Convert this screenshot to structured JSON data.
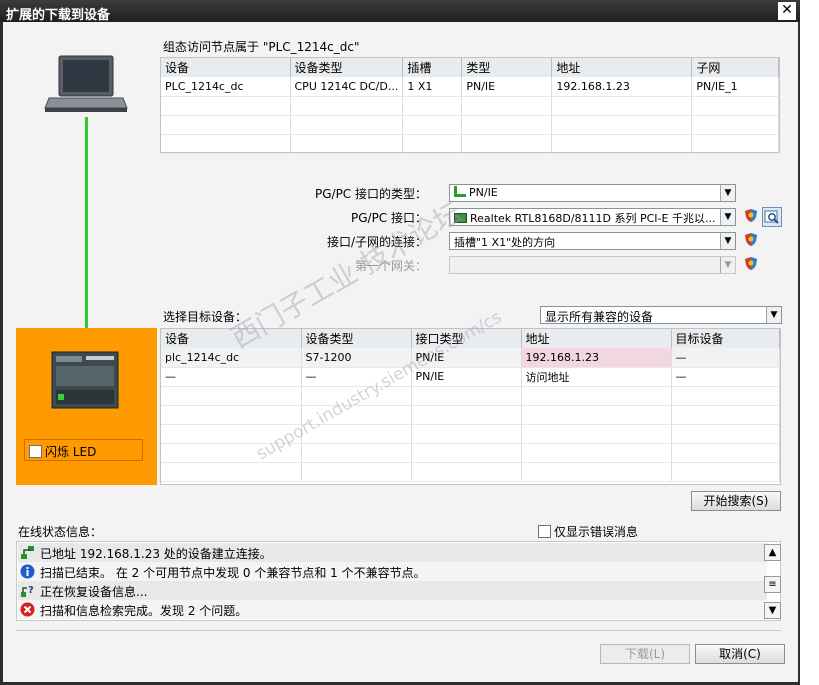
{
  "window": {
    "title": "扩展的下载到设备",
    "close": "✕"
  },
  "config_section": {
    "caption": "组态访问节点属于 \"PLC_1214c_dc\"",
    "headers": [
      "设备",
      "设备类型",
      "插槽",
      "类型",
      "地址",
      "子网"
    ],
    "row": [
      "PLC_1214c_dc",
      "CPU 1214C DC/D...",
      "1 X1",
      "PN/IE",
      "192.168.1.23",
      "PN/IE_1"
    ]
  },
  "interface": {
    "pgpc_type_label": "PG/PC 接口的类型：",
    "pgpc_type_value": "PN/IE",
    "pgpc_label": "PG/PC 接口：",
    "pgpc_value": "Realtek RTL8168D/8111D 系列 PCI-E 千兆以...",
    "subnet_label": "接口/子网的连接：",
    "subnet_value": "插槽\"1 X1\"处的方向",
    "gateway_label": "第一个网关：",
    "gateway_value": ""
  },
  "target_section": {
    "caption": "选择目标设备：",
    "filter_value": "显示所有兼容的设备",
    "headers": [
      "设备",
      "设备类型",
      "接口类型",
      "地址",
      "目标设备"
    ],
    "rows": [
      [
        "plc_1214c_dc",
        "S7-1200",
        "PN/IE",
        "192.168.1.23",
        "—"
      ],
      [
        "—",
        "—",
        "PN/IE",
        "访问地址",
        "—"
      ]
    ],
    "flash_led": "闪烁 LED",
    "search_button": "开始搜索(S)"
  },
  "status": {
    "caption": "在线状态信息：",
    "errors_only": "仅显示错误消息",
    "messages": [
      {
        "icon": "network-connect-icon",
        "text": "已地址 192.168.1.23 处的设备建立连接。"
      },
      {
        "icon": "info-icon",
        "text": "扫描已结束。 在 2 个可用节点中发现 0 个兼容节点和 1 个不兼容节点。"
      },
      {
        "icon": "network-query-icon",
        "text": "正在恢复设备信息..."
      },
      {
        "icon": "error-icon",
        "text": "扫描和信息检索完成。发现 2 个问题。"
      }
    ]
  },
  "footer": {
    "download": "下载(L)",
    "cancel": "取消(C)"
  },
  "watermark": {
    "line1": "西门子工业 技术论坛",
    "line2": "support.industry.siemens.com/cs"
  },
  "colors": {
    "accent_orange": "#ff9a00",
    "connection_green": "#2ecc2e",
    "highlight_pink": "#f2d6e0"
  }
}
